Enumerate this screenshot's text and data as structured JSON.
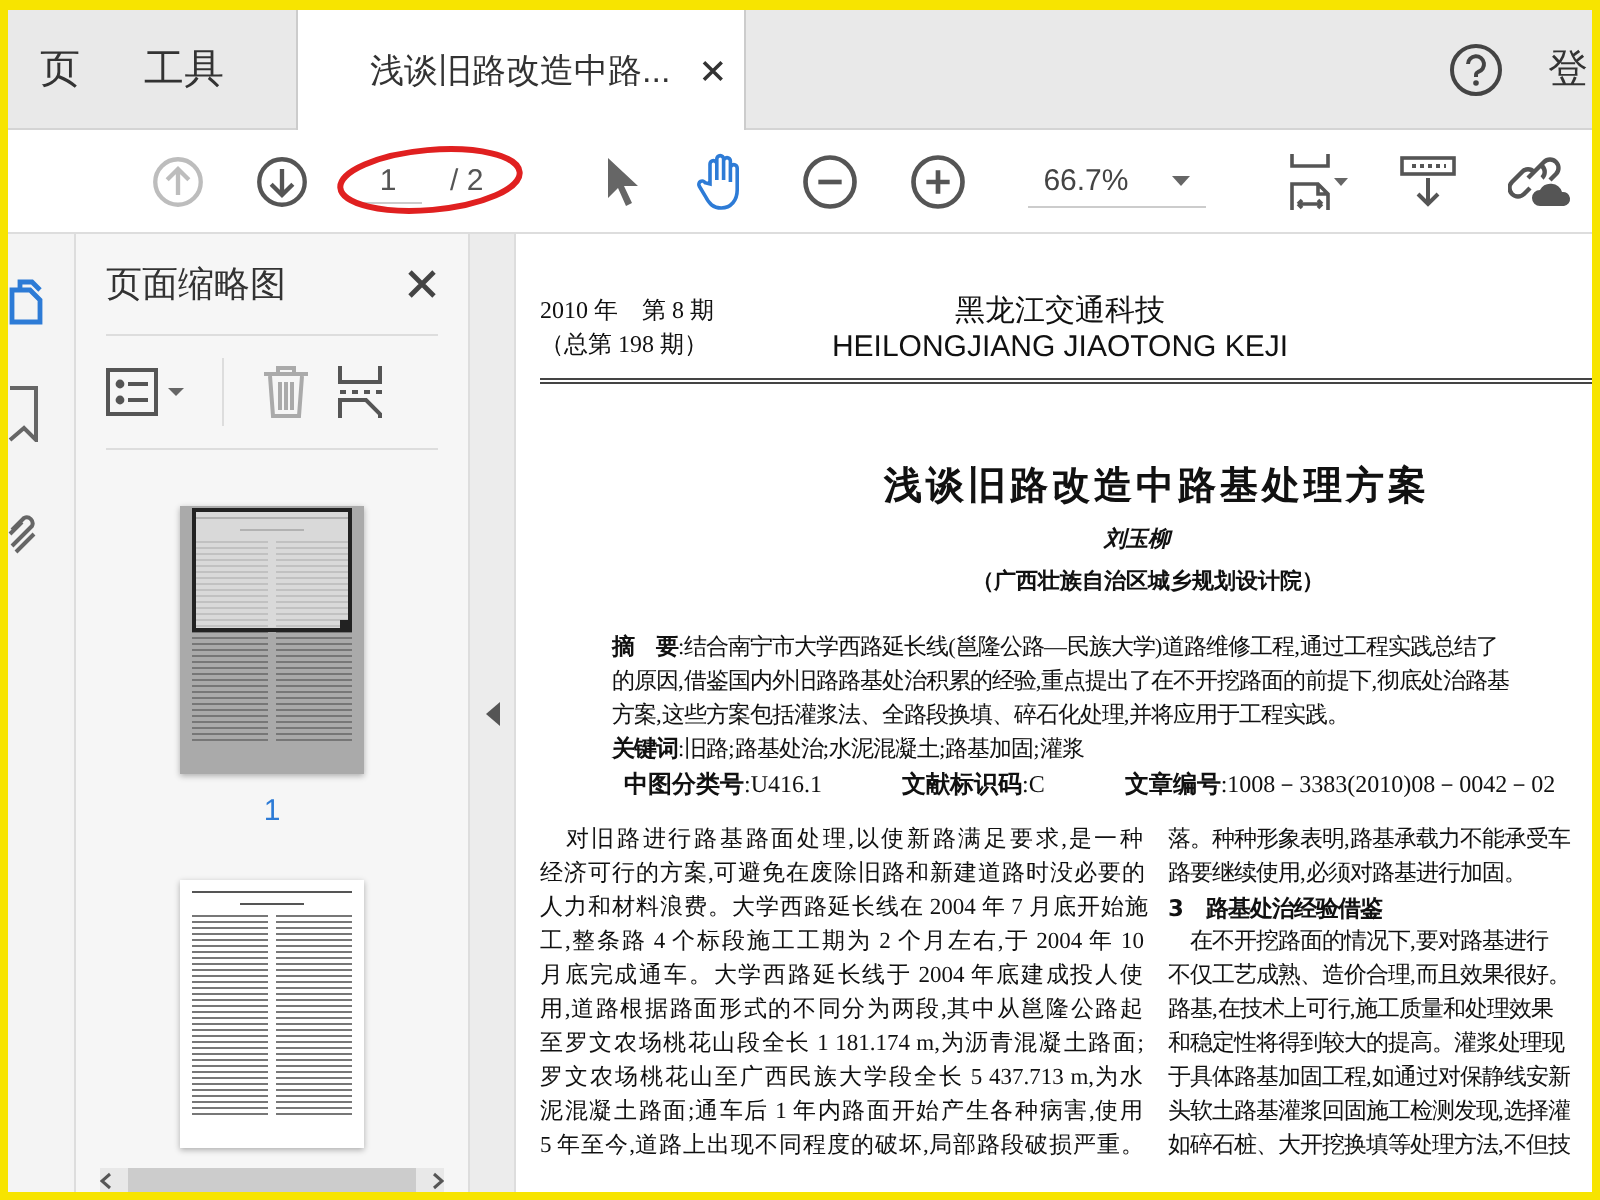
{
  "tabs": [
    {
      "label": "页",
      "selected": false
    },
    {
      "label": "工具",
      "selected": false
    },
    {
      "label": "浅谈旧路改造中路...",
      "selected": true
    }
  ],
  "header_right": {
    "signin": "登"
  },
  "toolbar": [
    {
      "kind": "prev",
      "disabled": true
    },
    {
      "kind": "next",
      "disabled": false
    },
    {
      "kind": "page",
      "value": "1",
      "total": "/ 2",
      "circled": true
    },
    {
      "kind": "sep"
    },
    {
      "kind": "select",
      "selected": false
    },
    {
      "kind": "hand",
      "selected": true
    },
    {
      "kind": "zoom_out"
    },
    {
      "kind": "zoom_in"
    },
    {
      "kind": "zoom",
      "value": "66.7%"
    },
    {
      "kind": "fit"
    },
    {
      "kind": "download"
    },
    {
      "kind": "link"
    }
  ],
  "sidebar_icons": [
    {
      "kind": "pages",
      "selected": true
    },
    {
      "kind": "bookmark",
      "selected": false
    },
    {
      "kind": "attachment",
      "selected": false
    }
  ],
  "thumbnail_panel": {
    "title": "页面缩略图",
    "pages": [
      {
        "label": "1",
        "selected": true
      },
      {
        "selected": false
      }
    ]
  },
  "document": {
    "issue": "2010 年　第 8 期",
    "issue_total": "（总第 198 期）",
    "journal": "黑龙江交通科技",
    "journal_en": "HEILONGJIANG JIAOTONG KEJI",
    "title": "浅谈旧路改造中路基处理方案",
    "author": "刘玉柳",
    "affiliation": "（广西壮族自治区城乡规划设计院）",
    "abstract": [
      "**摘　要**:结合南宁市大学西路延长线(邕隆公路—民族大学)道路维修工程,通过工程实践总结了",
      "的原因,借鉴国内外旧路路基处治积累的经验,重点提出了在不开挖路面的前提下,彻底处治路基",
      "方案,这些方案包括灌浆法、全路段换填、碎石化处理,并将应用于工程实践。"
    ],
    "keywords": "**关键词**:旧路;路基处治;水泥混凝土;路基加固;灌浆",
    "classification": [
      "**中图分类号**:U416.1",
      "**文献标识码**:C",
      "**文章编号**:1008－3383(2010)08－0042－02"
    ],
    "left_column": [
      "　对旧路进行路基路面处理,以使新路满足要求,是一种",
      "经济可行的方案,可避免在废除旧路和新建道路时没必要的",
      "人力和材料浪费。大学西路延长线在 2004 年 7 月底开始施",
      "工,整条路 4 个标段施工工期为 2 个月左右,于 2004 年 10",
      "月底完成通车。大学西路延长线于 2004 年底建成投人使",
      "用,道路根据路面形式的不同分为两段,其中从邕隆公路起",
      "至罗文农场桃花山段全长 1 181.174 m,为沥青混凝土路面;",
      "罗文农场桃花山至广西民族大学段全长 5 437.713 m,为水",
      "泥混凝土路面;通车后 1 年内路面开始产生各种病害,使用",
      "5 年至今,道路上出现不同程度的破坏,局部路段破损严重。"
    ],
    "right_column": [
      {
        "kind": "text",
        "text": "落。种种形象表明,路基承载力不能承受车"
      },
      {
        "kind": "text",
        "text": "路要继续使用,必须对路基进行加固。"
      },
      {
        "kind": "heading",
        "text": "3　路基处治经验借鉴"
      },
      {
        "kind": "text",
        "text": "　在不开挖路面的情况下,要对路基进行"
      },
      {
        "kind": "text",
        "text": "不仅工艺成熟、造价合理,而且效果很好。"
      },
      {
        "kind": "text",
        "text": "路基,在技术上可行,施工质量和处理效果"
      },
      {
        "kind": "text",
        "text": "和稳定性将得到较大的提高。灌浆处理现"
      },
      {
        "kind": "text",
        "text": "于具体路基加固工程,如通过对保静线安新"
      },
      {
        "kind": "text",
        "text": "头软土路基灌浆回固施工检测发现,选择灌"
      },
      {
        "kind": "text",
        "text": "如碎石桩、大开挖换填等处理方法,不但技"
      }
    ]
  }
}
